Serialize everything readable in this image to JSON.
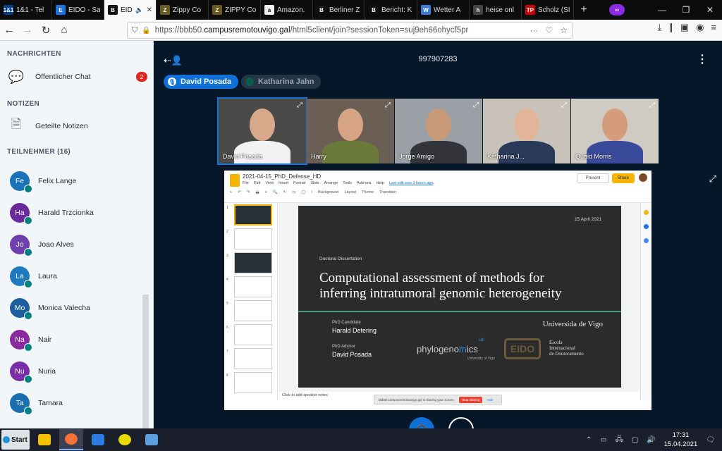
{
  "browser": {
    "tabs": [
      {
        "label": "1&1 - Tel",
        "fav_color": "#003d8f",
        "fav_text": "1&1"
      },
      {
        "label": "EIDO - Sa",
        "fav_color": "#1a73e8",
        "fav_text": "E"
      },
      {
        "label": "EIDO",
        "fav_color": "#111111",
        "fav_text": "B",
        "active": true
      },
      {
        "label": "Zippy Co",
        "fav_color": "#6b5a20",
        "fav_text": "Z"
      },
      {
        "label": "ZIPPY Co",
        "fav_color": "#6b5a20",
        "fav_text": "Z"
      },
      {
        "label": "Amazon.",
        "fav_color": "#f0f0f0",
        "fav_text": "a"
      },
      {
        "label": "Berliner Z",
        "fav_color": "#111111",
        "fav_text": "B"
      },
      {
        "label": "Bericht: K",
        "fav_color": "#111111",
        "fav_text": "B"
      },
      {
        "label": "Wetter A",
        "fav_color": "#3a7bd5",
        "fav_text": "W"
      },
      {
        "label": "heise onl",
        "fav_color": "#444444",
        "fav_text": "h"
      },
      {
        "label": "Scholz (SI",
        "fav_color": "#cc0000",
        "fav_text": "TP"
      }
    ],
    "url_prefix": "https://bbb50.",
    "url_host": "campusremotouvigo.gal",
    "url_path": "/html5client/join?sessionToken=suj9eh66ohycf5pr"
  },
  "sidebar": {
    "messages_title": "NACHRICHTEN",
    "public_chat": "Öffentlicher Chat",
    "public_chat_badge": "2",
    "notes_title": "NOTIZEN",
    "shared_notes": "Geteilte Notizen",
    "participants_title": "TEILNEHMER (16)",
    "users": [
      {
        "initials": "Fe",
        "name": "Felix Lange",
        "color": "#1a73b8"
      },
      {
        "initials": "Ha",
        "name": "Harald Trzcionka",
        "color": "#6a2a9c"
      },
      {
        "initials": "Jo",
        "name": "Joao Alves",
        "color": "#6f3fb0"
      },
      {
        "initials": "La",
        "name": "Laura",
        "color": "#1f7bbf"
      },
      {
        "initials": "Mo",
        "name": "Monica Valecha",
        "color": "#1d5f9e"
      },
      {
        "initials": "Na",
        "name": "Nair",
        "color": "#8a2aa0"
      },
      {
        "initials": "Nu",
        "name": "Nuria",
        "color": "#7a2fa8"
      },
      {
        "initials": "Ta",
        "name": "Tamara",
        "color": "#1a6fb0"
      }
    ]
  },
  "main": {
    "meeting_id": "997907283",
    "talkers": [
      "David Posada",
      "Katharina Jahn"
    ],
    "videos": [
      {
        "name": "David Posada",
        "bg": "#4a4a48",
        "skin": "#d9a88a",
        "shirt": "#f2f2f2"
      },
      {
        "name": "Harry",
        "bg": "#6b5f55",
        "skin": "#d7a585",
        "shirt": "#6b7a3a"
      },
      {
        "name": "Jorge Amigo",
        "bg": "#9aa0a5",
        "skin": "#c99a7a",
        "shirt": "#33353a"
      },
      {
        "name": "Katharina J...",
        "bg": "#c8c2b8",
        "skin": "#e2b598",
        "shirt": "#2a3a5a"
      },
      {
        "name": "Quaid Morris",
        "bg": "#cfcac2",
        "skin": "#d59c7c",
        "shirt": "#3a4a9a"
      }
    ]
  },
  "presentation": {
    "doc_title": "2021-04-15_PhD_Defense_HD",
    "menu": [
      "File",
      "Edit",
      "View",
      "Insert",
      "Format",
      "Slide",
      "Arrange",
      "Tools",
      "Add-ons",
      "Help"
    ],
    "last_edit": "Last edit was 3 hours ago",
    "toolbar": [
      "Background",
      "Layout",
      "Theme",
      "Transition"
    ],
    "present_label": "Present",
    "share_label": "Share",
    "notes_placeholder": "Click to add speaker notes",
    "sharing_notice": "bbb50.campusremotouvigo.gal is sharing your screen.",
    "stop_sharing": "Stop sharing",
    "hide": "Hide",
    "slide": {
      "date": "15 April 2021",
      "kicker": "Doctoral Dissertation",
      "title_line1": "Computational assessment of methods for",
      "title_line2": "inferring intratumoral genomic heterogeneity",
      "candidate_label": "PhD Candidate",
      "candidate": "Harald Detering",
      "advisor_label": "PhD Advisor",
      "advisor": "David Posada",
      "uvigo": "Universida de Vigo",
      "phylo_a": "phylogeno",
      "phylo_b": "m",
      "phylo_c": "ics",
      "phylo_lab": "lab",
      "phylo_uni": "University of Vigo",
      "eido": "EIDO",
      "eido_line1": "Escola",
      "eido_line2": "Internacional",
      "eido_line3": "de Doutoramento"
    }
  },
  "taskbar": {
    "start": "Start",
    "time": "17:31",
    "date": "15.04.2021"
  }
}
